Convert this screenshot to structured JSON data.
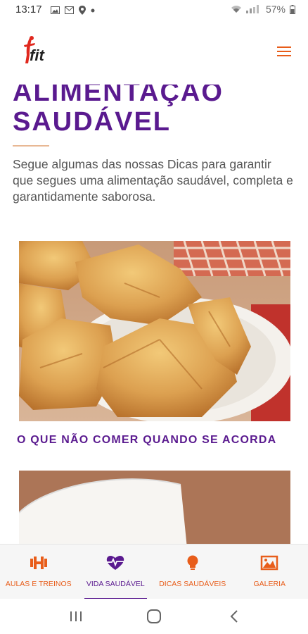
{
  "status_bar": {
    "time": "13:17",
    "battery": "57%"
  },
  "header": {
    "logo_text": "fit"
  },
  "page": {
    "title_line1": "ALIMENTAÇÃO",
    "title_line2": "SAUDÁVEL",
    "intro": "Segue algumas das nossas Dicas para garantir que segues uma alimentação saudável, completa e garantidamente saborosa."
  },
  "articles": [
    {
      "title": "O QUE NÃO COMER QUANDO SE ACORDA"
    }
  ],
  "bottom_nav": {
    "items": [
      {
        "label": "AULAS E TREINOS",
        "icon": "dumbbell-icon"
      },
      {
        "label": "VIDA SAUDÁVEL",
        "icon": "heart-pulse-icon"
      },
      {
        "label": "DICAS SAUDÁVEIS",
        "icon": "lightbulb-icon"
      },
      {
        "label": "GALERIA",
        "icon": "image-icon"
      }
    ],
    "active_index": 1
  },
  "colors": {
    "accent": "#e85d1a",
    "brand_purple": "#5a1a8f"
  }
}
